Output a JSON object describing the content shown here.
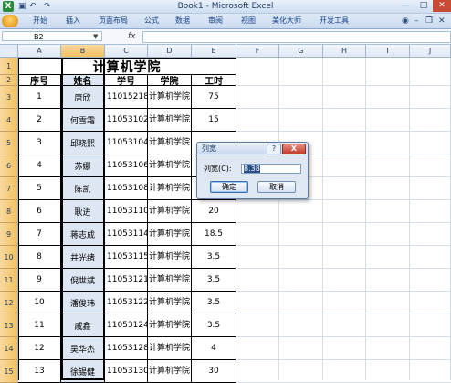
{
  "window": {
    "title": "Book1 - Microsoft Excel",
    "app_icon": "excel-logo-icon",
    "quick_access": [
      "save-icon",
      "undo-icon",
      "redo-icon"
    ],
    "controls": [
      "minimize-icon",
      "maximize-icon",
      "close-icon"
    ]
  },
  "ribbon": {
    "tabs": [
      "开始",
      "插入",
      "页面布局",
      "公式",
      "数据",
      "审阅",
      "视图",
      "美化大师",
      "开发工具"
    ]
  },
  "formula_bar": {
    "name_box": "B2",
    "fx": "fx",
    "formula": ""
  },
  "grid": {
    "columns": [
      "A",
      "B",
      "C",
      "D",
      "E",
      "F",
      "G",
      "H",
      "I",
      "J"
    ],
    "rows": [
      "1",
      "2",
      "3",
      "4",
      "5",
      "6",
      "7",
      "8",
      "9",
      "10",
      "11",
      "12",
      "13",
      "14",
      "15"
    ],
    "selected_column": "B"
  },
  "table": {
    "title": "计算机学院",
    "headers": [
      "序号",
      "姓名",
      "学号",
      "学院",
      "工时"
    ],
    "college": "计算机学院",
    "rows": [
      {
        "no": "1",
        "name": "唐欣",
        "id": "11015218",
        "hours": "75"
      },
      {
        "no": "2",
        "name": "何雪霜",
        "id": "11053102",
        "hours": "15"
      },
      {
        "no": "3",
        "name": "邱晓熙",
        "id": "11053104",
        "hours": ""
      },
      {
        "no": "4",
        "name": "苏娜",
        "id": "11053106",
        "hours": ""
      },
      {
        "no": "5",
        "name": "陈凯",
        "id": "11053108",
        "hours": ""
      },
      {
        "no": "6",
        "name": "耿进",
        "id": "11053110",
        "hours": "20"
      },
      {
        "no": "7",
        "name": "蒋志成",
        "id": "11053114",
        "hours": "18.5"
      },
      {
        "no": "8",
        "name": "井光绪",
        "id": "11053115",
        "hours": "3.5"
      },
      {
        "no": "9",
        "name": "倪世斌",
        "id": "11053121",
        "hours": "3.5"
      },
      {
        "no": "10",
        "name": "潘俊玮",
        "id": "11053122",
        "hours": "3.5"
      },
      {
        "no": "11",
        "name": "戚鑫",
        "id": "11053124",
        "hours": "3.5"
      },
      {
        "no": "12",
        "name": "吴华杰",
        "id": "11053128",
        "hours": "4"
      },
      {
        "no": "13",
        "name": "徐锡健",
        "id": "11053130",
        "hours": "30"
      }
    ]
  },
  "dialog": {
    "title": "列宽",
    "help": "?",
    "close": "X",
    "label": "列宽(C):",
    "value": "8.38",
    "ok": "确定",
    "cancel": "取消"
  }
}
